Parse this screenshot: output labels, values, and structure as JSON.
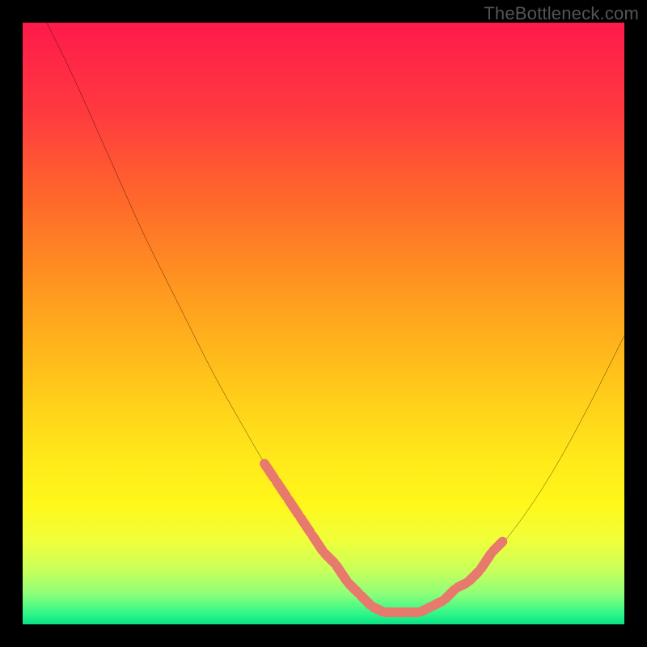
{
  "watermark": "TheBottleneck.com",
  "chart_data": {
    "type": "line",
    "title": "",
    "xlabel": "",
    "ylabel": "",
    "xlim": [
      0,
      100
    ],
    "ylim": [
      0,
      100
    ],
    "grid": false,
    "legend": false,
    "gradient_stops": [
      {
        "offset": 0.0,
        "color": "#ff1a4b"
      },
      {
        "offset": 0.15,
        "color": "#ff3a3f"
      },
      {
        "offset": 0.3,
        "color": "#ff6a2a"
      },
      {
        "offset": 0.45,
        "color": "#ff9a1f"
      },
      {
        "offset": 0.6,
        "color": "#ffc71a"
      },
      {
        "offset": 0.72,
        "color": "#ffe81a"
      },
      {
        "offset": 0.8,
        "color": "#fff71a"
      },
      {
        "offset": 0.86,
        "color": "#f0ff3a"
      },
      {
        "offset": 0.91,
        "color": "#c8ff5a"
      },
      {
        "offset": 0.95,
        "color": "#8cff7a"
      },
      {
        "offset": 0.985,
        "color": "#28f58a"
      },
      {
        "offset": 1.0,
        "color": "#0be084"
      }
    ],
    "series": [
      {
        "name": "bottleneck-curve",
        "color": "#000000",
        "x": [
          4,
          8,
          12,
          16,
          20,
          24,
          28,
          32,
          36,
          40,
          44,
          48,
          52,
          55,
          58,
          61,
          65,
          70,
          76,
          82,
          88,
          94,
          100
        ],
        "values": [
          100,
          92,
          83,
          74,
          65,
          57,
          49,
          41,
          34,
          27,
          21,
          15,
          10,
          6,
          3,
          2,
          2,
          4,
          9,
          16,
          25,
          36,
          48
        ]
      }
    ],
    "highlight_segments": [
      {
        "name": "left-falling-highlight",
        "color": "#e8796d",
        "x": [
          40,
          42,
          44,
          46,
          48,
          50,
          52,
          54,
          56,
          58,
          60
        ],
        "values": [
          27,
          24,
          21,
          18,
          15,
          12,
          10,
          7,
          5,
          3,
          2
        ]
      },
      {
        "name": "bottom-highlight",
        "color": "#e8796d",
        "x": [
          58,
          60,
          62,
          64,
          66,
          68
        ],
        "values": [
          3,
          2,
          2,
          2,
          2,
          3
        ]
      },
      {
        "name": "right-rising-highlight",
        "color": "#e8796d",
        "x": [
          68,
          70,
          72,
          74,
          76,
          78,
          80
        ],
        "values": [
          3,
          4,
          6,
          7,
          9,
          12,
          14
        ]
      }
    ]
  }
}
